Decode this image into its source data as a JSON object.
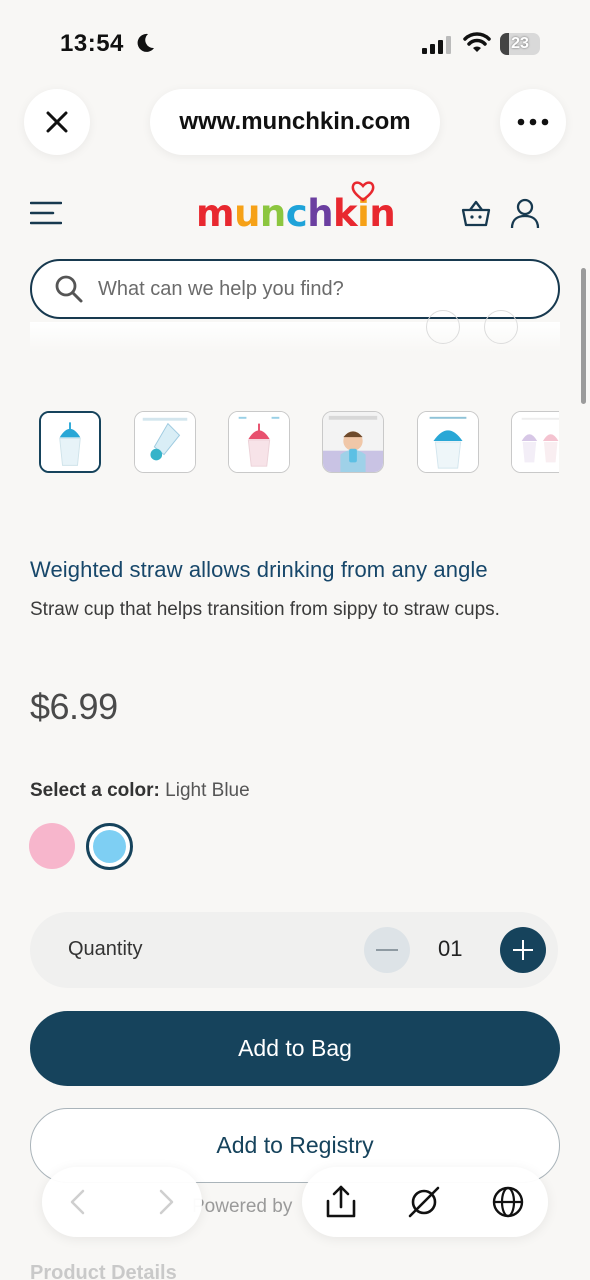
{
  "status_bar": {
    "time": "13:54",
    "battery": "23",
    "battery_level": 0.23
  },
  "browser": {
    "url": "www.munchkin.com"
  },
  "header": {
    "logo_text": "munchkin",
    "logo_letters": [
      {
        "ch": "m",
        "color": "#e8282f"
      },
      {
        "ch": "u",
        "color": "#f6a117"
      },
      {
        "ch": "n",
        "color": "#8cc63f"
      },
      {
        "ch": "c",
        "color": "#1fa3d9"
      },
      {
        "ch": "h",
        "color": "#6b3fa0"
      },
      {
        "ch": "k",
        "color": "#e8282f"
      },
      {
        "ch": "i",
        "color": "#f6a117"
      },
      {
        "ch": "n",
        "color": "#e8282f"
      }
    ],
    "icons": [
      "menu-icon",
      "bag-icon",
      "user-icon"
    ]
  },
  "search": {
    "placeholder": "What can we help you find?"
  },
  "product": {
    "headline": "Weighted straw allows drinking from any angle",
    "description": "Straw cup that helps transition from sippy to straw cups.",
    "price": "$6.99",
    "color_label": "Select a color:",
    "selected_color": "Light Blue",
    "colors": [
      {
        "name": "Pink",
        "hex": "#f7b6cc"
      },
      {
        "name": "Light Blue",
        "hex": "#7ecff3"
      }
    ],
    "quantity_label": "Quantity",
    "quantity": "01",
    "add_to_bag": "Add to Bag",
    "add_to_registry": "Add to Registry",
    "powered_by": "Powered by",
    "details_heading": "Product Details"
  },
  "colors": {
    "primary": "#16435c",
    "headline": "#17476a"
  }
}
